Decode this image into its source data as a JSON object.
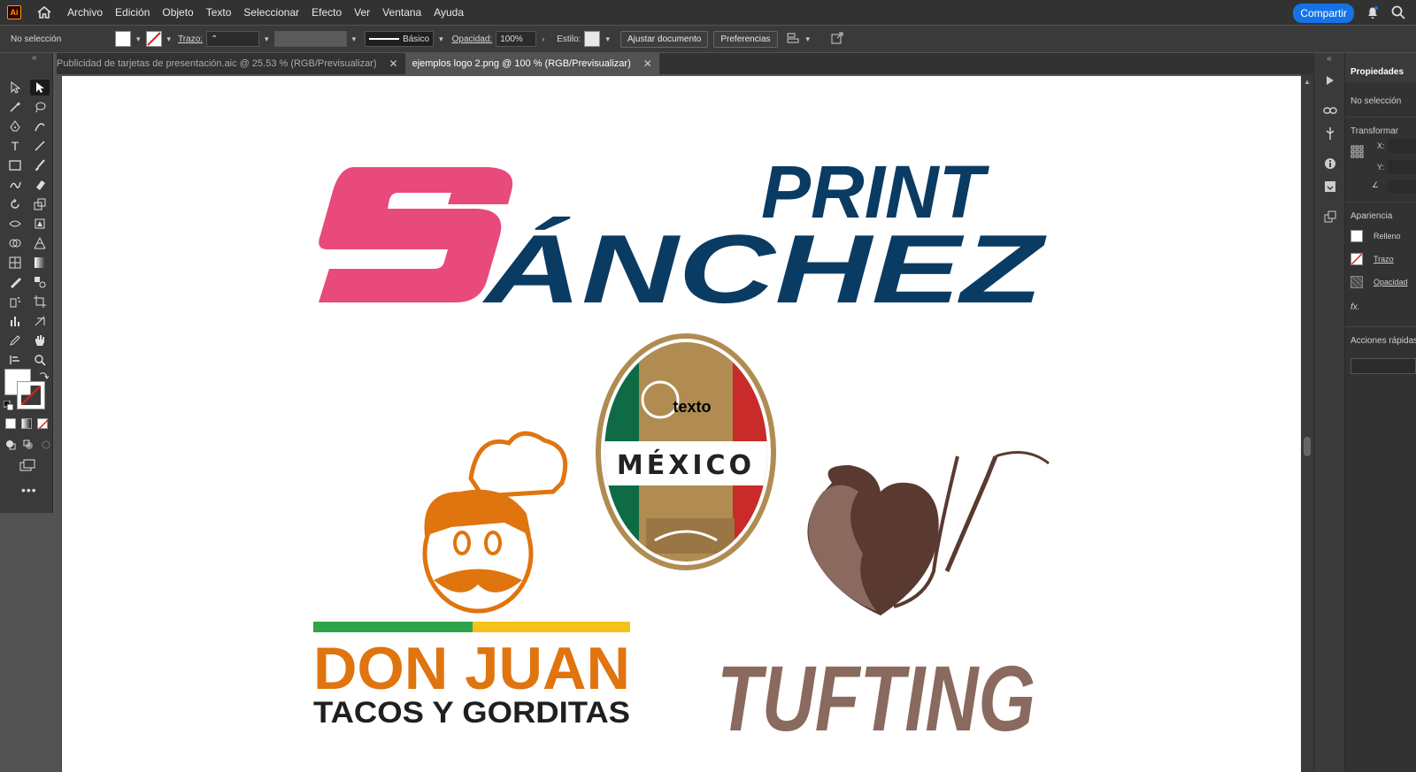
{
  "app": {
    "logo": "Ai"
  },
  "menu": [
    "Archivo",
    "Edición",
    "Objeto",
    "Texto",
    "Seleccionar",
    "Efecto",
    "Ver",
    "Ventana",
    "Ayuda"
  ],
  "share_label": "Compartir",
  "control": {
    "selection": "No selección",
    "stroke_label": "Trazo:",
    "brush_label": "Básico",
    "opacity_label": "Opacidad:",
    "opacity_value": "100%",
    "style_label": "Estilo:",
    "adjust_doc": "Ajustar documento",
    "preferences": "Preferencias"
  },
  "tabs": [
    {
      "label": "Publicidad de tarjetas de presentación.aic @ 25.53 % (RGB/Previsualizar)"
    },
    {
      "label": "ejemplos logo 2.png @ 100 % (RGB/Previsualizar)"
    }
  ],
  "properties": {
    "title": "Propiedades",
    "selection": "No selección",
    "transform": "Transformar",
    "x_label": "X:",
    "y_label": "Y:",
    "appearance": "Apariencia",
    "fill": "Relleno",
    "stroke": "Trazo",
    "opacity": "Opacidad",
    "fx": "fx.",
    "quick_actions": "Acciones rápidas"
  },
  "artwork": {
    "print_top": "PRINT",
    "print_main": "SÁNCHEZ",
    "print_s": "S",
    "mexico_overlay": "texto",
    "mexico_word": "MÉXICO",
    "donjuan_title": "DON JUAN",
    "donjuan_sub": "TACOS Y GORDITAS",
    "tufting": "TUFTING"
  },
  "colors": {
    "accent": "#1473e6",
    "print_pink": "#e84a7b",
    "print_blue": "#0a3b63",
    "donjuan_orange": "#e0740f",
    "donjuan_green": "#2ea44a",
    "donjuan_yellow": "#f6c21a",
    "mexico_gold": "#b08c52",
    "mexico_green": "#0e6b45",
    "mexico_red": "#c92a2a",
    "tufting_brown": "#8a6a5e",
    "heart_dark": "#5a3a30"
  }
}
